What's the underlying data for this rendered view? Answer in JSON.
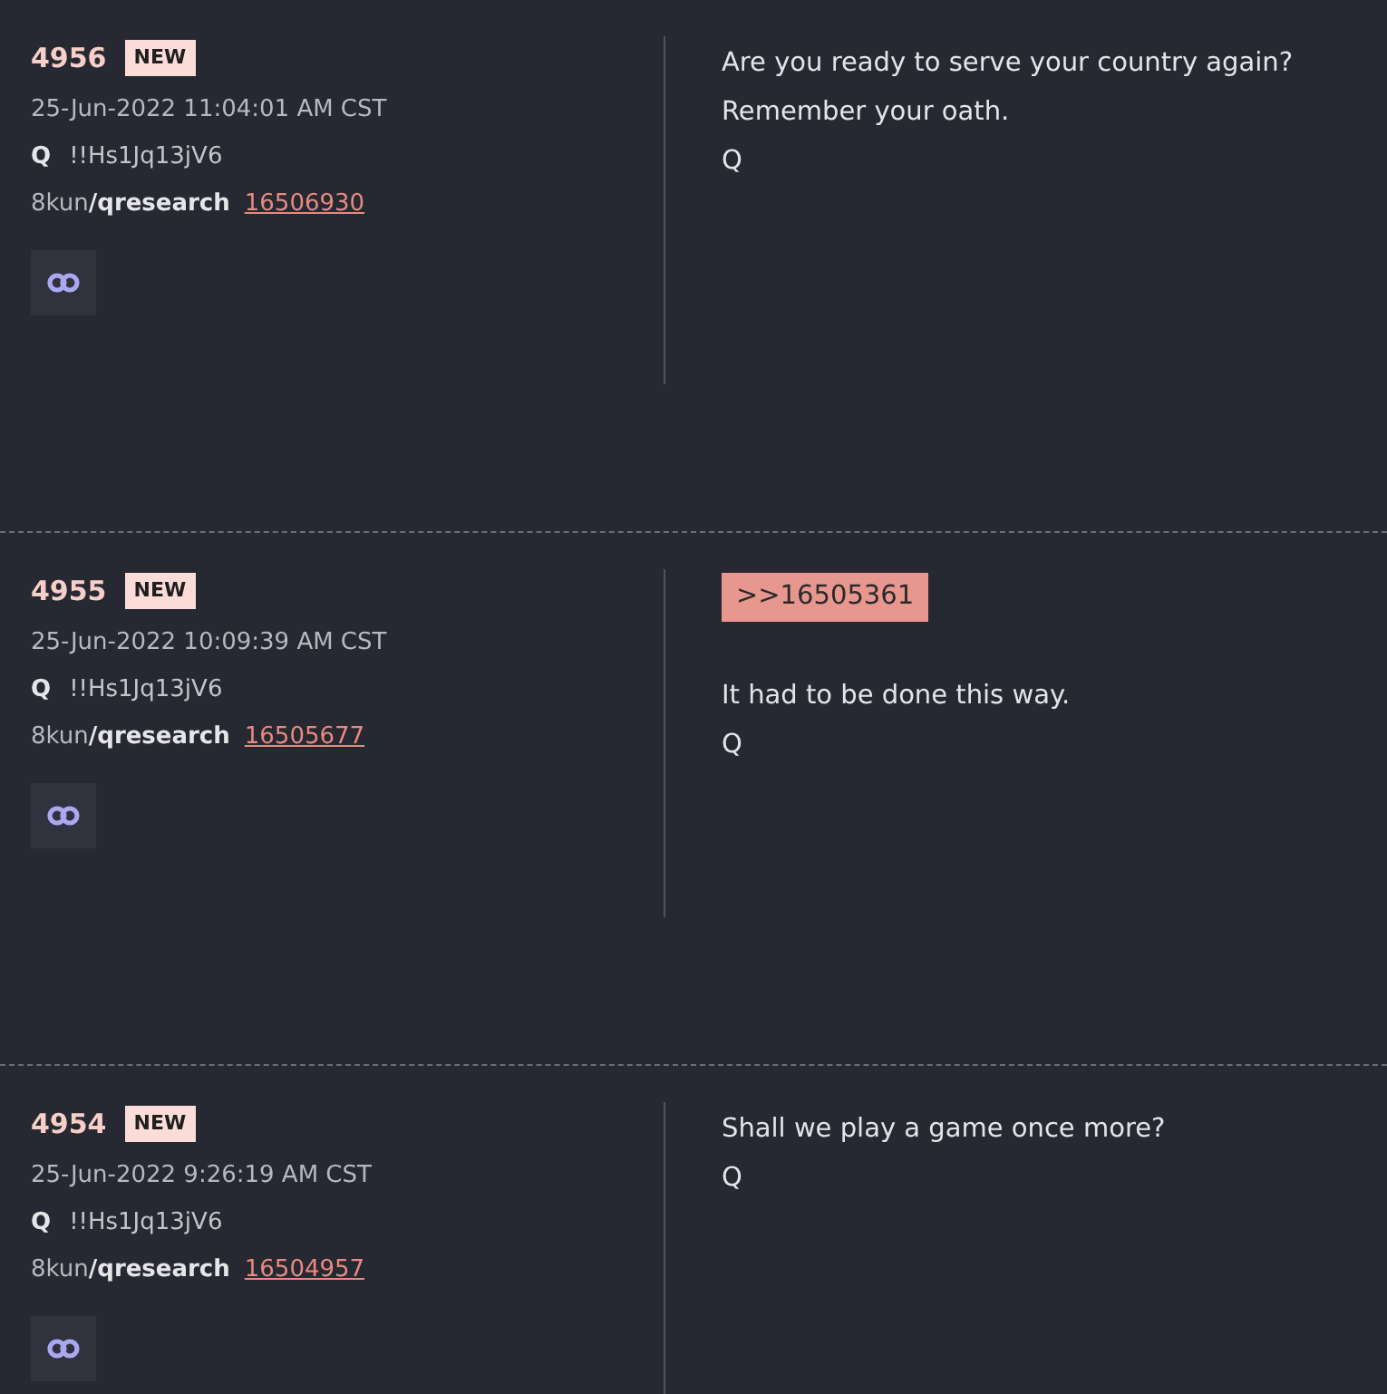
{
  "posts": [
    {
      "number": "4956",
      "badge": "NEW",
      "date": "25-Jun-2022 11:04:01 AM CST",
      "author": "Q",
      "tripcode": "!!Hs1Jq13jV6",
      "site": "8kun",
      "board": "/qresearch",
      "post_link": "16506930",
      "lines": [
        "Are you ready to serve your country again?",
        "Remember your oath.",
        "Q"
      ]
    },
    {
      "number": "4955",
      "badge": "NEW",
      "date": "25-Jun-2022 10:09:39 AM CST",
      "author": "Q",
      "tripcode": "!!Hs1Jq13jV6",
      "site": "8kun",
      "board": "/qresearch",
      "post_link": "16505677",
      "reply_to": ">>16505361",
      "lines": [
        "It had to be done this way.",
        "Q"
      ]
    },
    {
      "number": "4954",
      "badge": "NEW",
      "date": "25-Jun-2022 9:26:19 AM CST",
      "author": "Q",
      "tripcode": "!!Hs1Jq13jV6",
      "site": "8kun",
      "board": "/qresearch",
      "post_link": "16504957",
      "lines": [
        "Shall we play a game once more?",
        "Q"
      ]
    }
  ]
}
